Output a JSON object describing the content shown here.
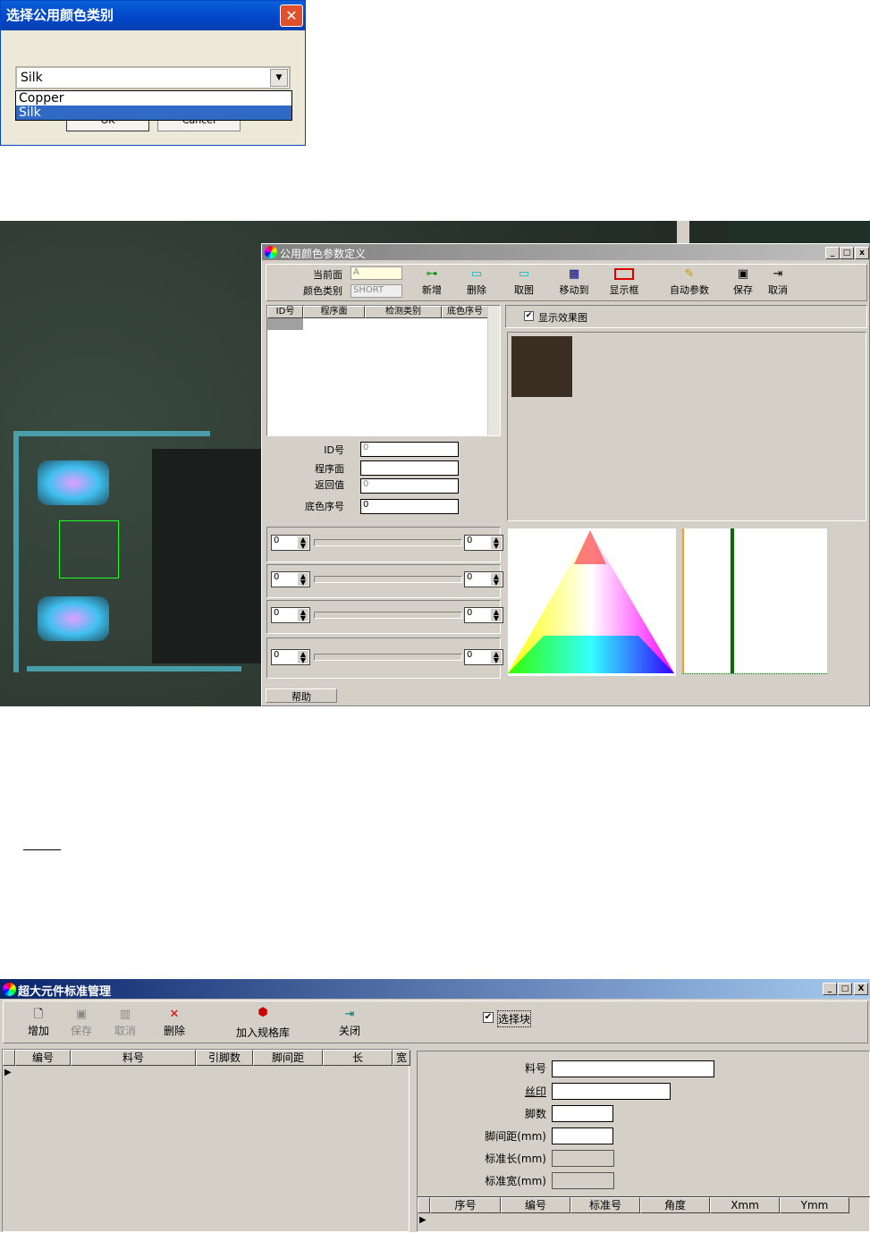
{
  "dialog1": {
    "title": "选择公用颜色类别",
    "close": "✕",
    "combo_value": "Silk",
    "options": [
      "Copper",
      "Silk"
    ],
    "selected": "Silk",
    "ok": "OK",
    "cancel": "Cancel"
  },
  "dialog2": {
    "title": "公用颜色参数定义",
    "controls": {
      "min": "_",
      "max": "□",
      "close": "x"
    },
    "side_label": "当前面",
    "side_value": "A",
    "color_type_label": "颜色类别",
    "color_type_value": "SHORT",
    "toolbar": [
      "新增",
      "删除",
      "取图",
      "移动到",
      "显示框",
      "自动参数",
      "保存",
      "取消"
    ],
    "table_headers": [
      "ID号",
      "程序面",
      "检测类别",
      "底色序号"
    ],
    "form": {
      "id_label": "ID号",
      "id_value": "0",
      "side_label": "程序面",
      "side_value": "",
      "ret_label": "返回值",
      "ret_value": "0",
      "bg_label": "底色序号",
      "bg_value": "0"
    },
    "sliders": [
      {
        "min": "0",
        "max": "0"
      },
      {
        "min": "0",
        "max": "0"
      },
      {
        "min": "0",
        "max": "0"
      },
      {
        "min": "0",
        "max": "0"
      }
    ],
    "show_effect": "显示效果图",
    "help": "帮助",
    "swatch_color": "#3a2e22"
  },
  "dialog3": {
    "title": "超大元件标准管理",
    "controls": {
      "min": "_",
      "max": "□",
      "close": "X"
    },
    "toolbar": [
      "增加",
      "保存",
      "取消",
      "删除",
      "加入规格库",
      "关闭"
    ],
    "select_block": "选择块",
    "left_headers": [
      "编号",
      "料号",
      "引脚数",
      "脚间距",
      "长",
      "宽"
    ],
    "form": [
      {
        "label": "料号",
        "value": ""
      },
      {
        "label": "丝印",
        "value": ""
      },
      {
        "label": "脚数",
        "value": ""
      },
      {
        "label": "脚间距(mm)",
        "value": ""
      },
      {
        "label": "标准长(mm)",
        "value": ""
      },
      {
        "label": "标准宽(mm)",
        "value": ""
      }
    ],
    "right_headers": [
      "序号",
      "编号",
      "标准号",
      "角度",
      "Xmm",
      "Ymm"
    ]
  }
}
